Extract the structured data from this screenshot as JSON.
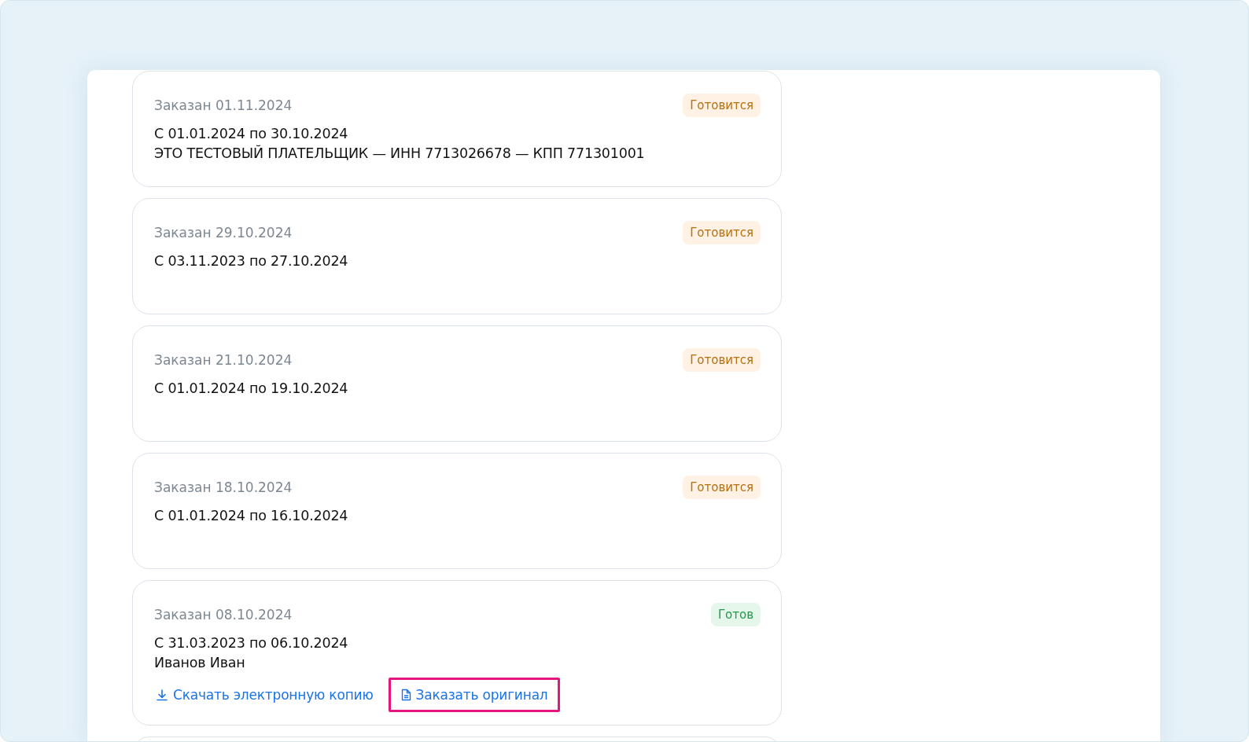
{
  "orders": [
    {
      "ordered": "Заказан 01.11.2024",
      "status": {
        "label": "Готовится",
        "kind": "preparing"
      },
      "lines": [
        "С 01.01.2024 по 30.10.2024",
        "ЭТО ТЕСТОВЫЙ ПЛАТЕЛЬЩИК — ИНН 7713026678 — КПП 771301001"
      ]
    },
    {
      "ordered": "Заказан 29.10.2024",
      "status": {
        "label": "Готовится",
        "kind": "preparing"
      },
      "lines": [
        "С 03.11.2023 по 27.10.2024"
      ]
    },
    {
      "ordered": "Заказан 21.10.2024",
      "status": {
        "label": "Готовится",
        "kind": "preparing"
      },
      "lines": [
        "С 01.01.2024 по 19.10.2024"
      ]
    },
    {
      "ordered": "Заказан 18.10.2024",
      "status": {
        "label": "Готовится",
        "kind": "preparing"
      },
      "lines": [
        "С 01.01.2024 по 16.10.2024"
      ]
    },
    {
      "ordered": "Заказан 08.10.2024",
      "status": {
        "label": "Готов",
        "kind": "ready"
      },
      "lines": [
        "С 31.03.2023 по 06.10.2024",
        "Иванов Иван"
      ],
      "actions": [
        {
          "label": "Скачать электронную копию",
          "kind": "download",
          "highlighted": false
        },
        {
          "label": "Заказать оригинал",
          "kind": "order",
          "highlighted": true
        }
      ]
    }
  ]
}
